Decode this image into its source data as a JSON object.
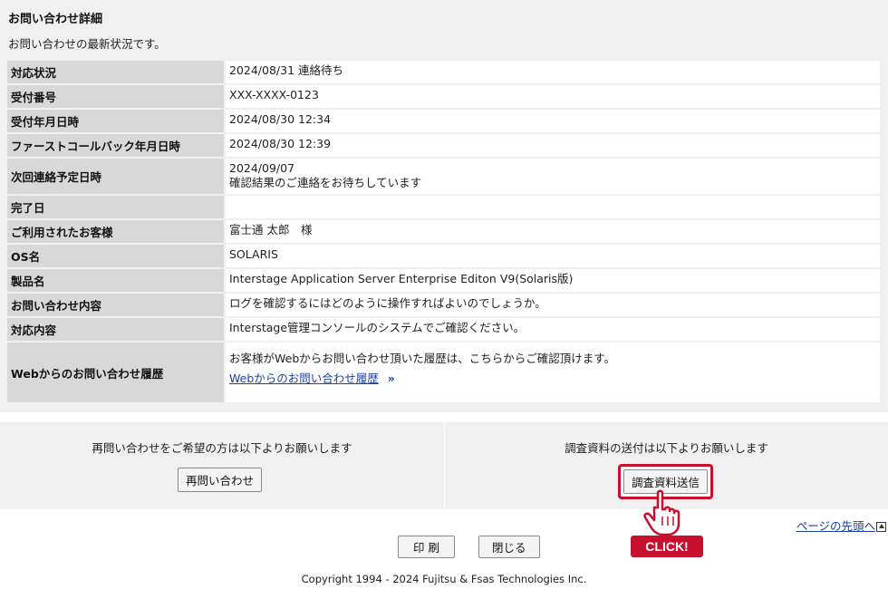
{
  "page": {
    "title": "お問い合わせ詳細",
    "subtitle": "お問い合わせの最新状況です。"
  },
  "detail_rows": [
    {
      "label": "対応状況",
      "value": "2024/08/31 連絡待ち"
    },
    {
      "label": "受付番号",
      "value": "XXX-XXXX-0123"
    },
    {
      "label": "受付年月日時",
      "value": "2024/08/30 12:34"
    },
    {
      "label": "ファーストコールバック年月日時",
      "value": "2024/08/30 12:39"
    },
    {
      "label": "次回連絡予定日時",
      "value": "2024/09/07",
      "value2": "確認結果のご連絡をお待ちしています"
    },
    {
      "label": "完了日",
      "value": ""
    },
    {
      "label": "ご利用されたお客様",
      "value": "富士通 太郎　様"
    },
    {
      "label": "OS名",
      "value": "SOLARIS"
    },
    {
      "label": "製品名",
      "value": "Interstage Application Server Enterprise Editon V9(Solaris版)"
    },
    {
      "label": "お問い合わせ内容",
      "value": "ログを確認するにはどのように操作すればよいのでしょうか。"
    },
    {
      "label": "対応内容",
      "value": "Interstage管理コンソールのシステムでご確認ください。"
    },
    {
      "label": "Webからのお問い合わせ履歴",
      "value": "お客様がWebからお問い合わせ頂いた履歴は、こちらからご確認頂けます。",
      "link": "Webからのお問い合わせ履歴"
    }
  ],
  "reinquiry": {
    "message": "再問い合わせをご希望の方は以下よりお願いします",
    "button": "再問い合わせ"
  },
  "send_material": {
    "message": "調査資料の送付は以下よりお願いします",
    "button": "調査資料送信"
  },
  "callout": {
    "text": "CLICK!",
    "color": "#c8102e"
  },
  "footer": {
    "to_top": "ページの先頭へ",
    "print": "印 刷",
    "close": "閉じる",
    "copyright": "Copyright 1994 - 2024 Fujitsu & Fsas Technologies Inc."
  },
  "colors": {
    "link": "#1a3fa8",
    "header_cell": "#d8d8d8",
    "panel": "#f0f0f0",
    "highlight": "#c8102e"
  }
}
